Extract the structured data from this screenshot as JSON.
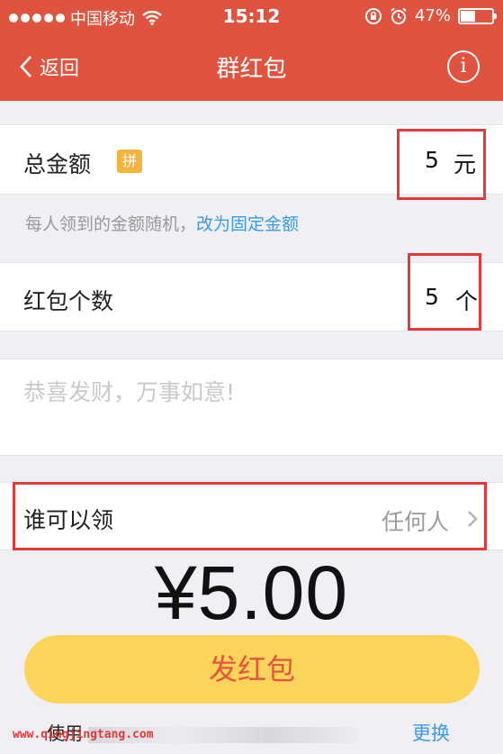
{
  "status": {
    "carrier": "中国移动",
    "time": "15:12",
    "battery": "47%",
    "battery_level": 0.47
  },
  "nav": {
    "back_label": "返回",
    "title": "群红包"
  },
  "total": {
    "label": "总金额",
    "badge": "拼",
    "value": "5",
    "unit": "元"
  },
  "hint": {
    "text": "每人领到的金额随机，",
    "link": "改为固定金额"
  },
  "count": {
    "label": "红包个数",
    "value": "5",
    "unit": "个"
  },
  "message": {
    "placeholder": "恭喜发财，万事如意!"
  },
  "who": {
    "label": "谁可以领",
    "value": "任何人"
  },
  "amount": "¥5.00",
  "send_label": "发红包",
  "footer": {
    "prefix": "使用",
    "change": "更换"
  },
  "watermark": "www.qingjingtang.com",
  "colors": {
    "header": "#e0533f",
    "button": "#fcd45a",
    "button_text": "#e4553f",
    "link": "#3a9be8",
    "highlight": "#e2393a"
  }
}
